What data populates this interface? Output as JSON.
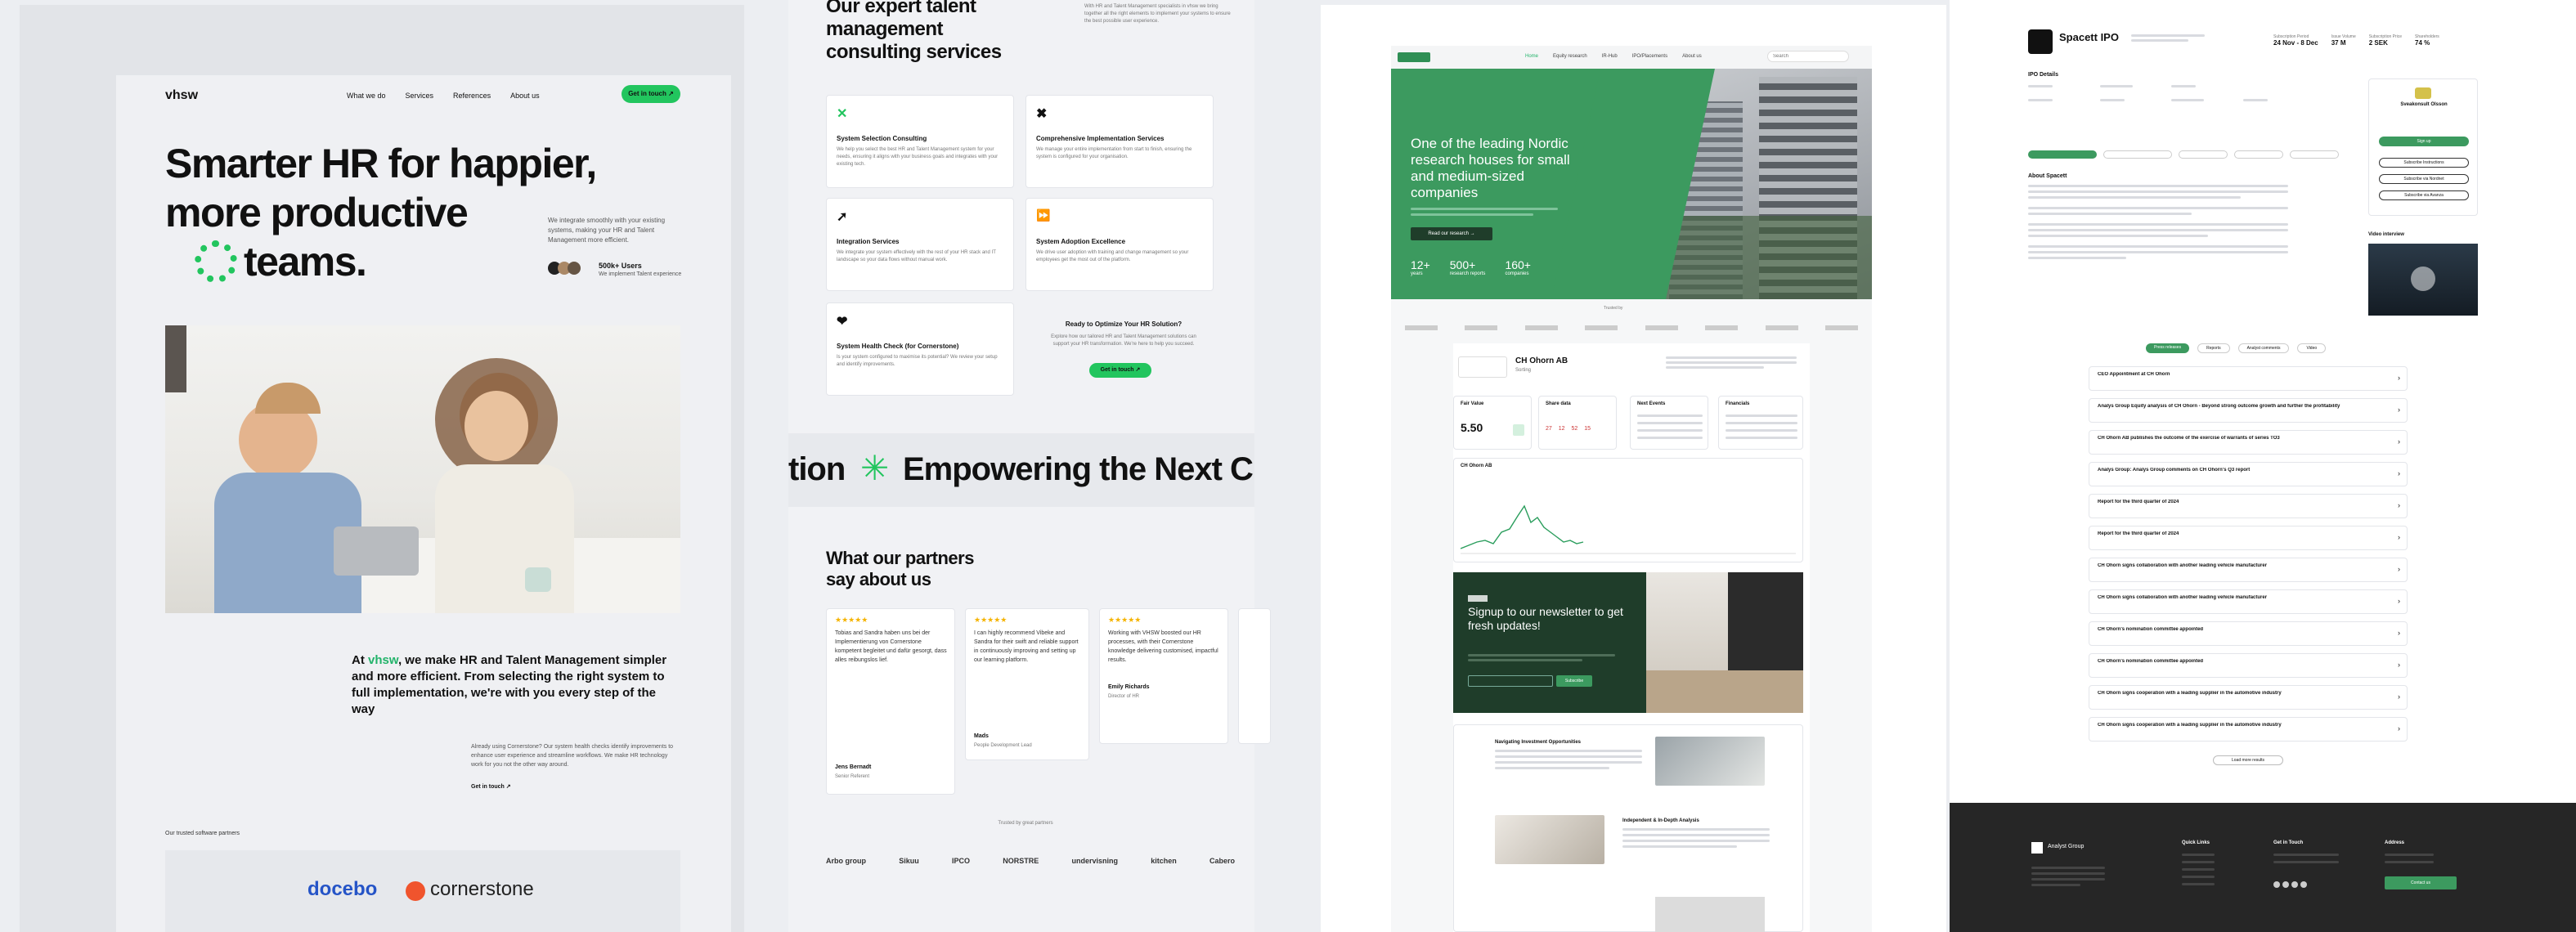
{
  "panel1": {
    "logo": "vhsw",
    "nav": [
      "What we do",
      "Services",
      "References",
      "About us"
    ],
    "nav_button": "Get in touch ↗",
    "hero_line1": "Smarter HR for happier,",
    "hero_line2": "more productive",
    "hero_line3": "teams.",
    "side_text": "We integrate smoothly with your existing systems, making your HR and Talent Management more efficient.",
    "users_count": "500k+ Users",
    "users_sub": "We implement Talent experience",
    "about_prefix": "At ",
    "about_brand": "vhsw",
    "about_rest": ", we make HR and Talent Management simpler and more efficient. From selecting the right system to full implementation, we're with you every step of the way",
    "about_sub": "Already using Cornerstone? Our system health checks identify improvements to enhance user experience and streamline workflows. We make HR technology work for you not the other way around.",
    "about_link": "Get in touch ↗",
    "partners_label": "Our trusted software partners",
    "partner1": "docebo",
    "partner2": "cornerstone"
  },
  "panel2": {
    "heading_line1": "Our expert talent",
    "heading_line2": "management",
    "heading_line3": "consulting services",
    "intro": "With HR and Talent Management specialists in vhsw we bring together all the right elements to implement your systems to ensure the best possible user experience.",
    "services": [
      {
        "title": "System Selection Consulting",
        "text": "We help you select the best HR and Talent Management system for your needs, ensuring it aligns with your business goals and integrates with your existing tech."
      },
      {
        "title": "Comprehensive Implementation Services",
        "text": "We manage your entire implementation from start to finish, ensuring the system is configured for your organisation."
      },
      {
        "title": "Integration Services",
        "text": "We integrate your system effectively with the rest of your HR stack and IT landscape so your data flows without manual work."
      },
      {
        "title": "System Adoption Excellence",
        "text": "We drive user adoption with training and change management so your employees get the most out of the platform."
      },
      {
        "title": "System Health Check (for Cornerstone)",
        "text": "Is your system configured to maximise its potential? We review your setup and identify improvements."
      }
    ],
    "cta_title": "Ready to Optimize Your HR Solution?",
    "cta_text": "Explore how our tailored HR and Talent Management solutions can support your HR transformation. We're here to help you succeed.",
    "cta_button": "Get in touch ↗",
    "marquee_left": "tion",
    "marquee_right": "Empowering the Next C",
    "testimonials_line1": "What our partners",
    "testimonials_line2": "say about us",
    "testimonials": [
      {
        "stars": "★★★★★",
        "text": "Tobias and Sandra haben uns bei der Implementierung von Cornerstone kompetent begleitet und dafür gesorgt, dass alles reibungslos lief.",
        "author": "Jens Bernadt",
        "role": "Senior Referent"
      },
      {
        "stars": "★★★★★",
        "text": "I can highly recommend Vibeke and Sandra for their swift and reliable support in continuously improving and setting up our learning platform.",
        "author": "Mads",
        "role": "People Development Lead"
      },
      {
        "stars": "★★★★★",
        "text": "Working with VHSW boosted our HR processes, with their Cornerstone knowledge delivering customised, impactful results.",
        "author": "Emily Richards",
        "role": "Director of HR"
      }
    ],
    "logos_label": "Trusted by great partners",
    "logos": [
      "Arbo group",
      "Sikuu",
      "IPCO",
      "NORSTRE",
      "undervisning",
      "kitchen",
      "Cabero"
    ]
  },
  "panel3": {
    "nav": [
      "Home",
      "Equity research",
      "IR-Hub",
      "IPO/Placements",
      "About us"
    ],
    "search_placeholder": "Search",
    "hero_title": "One of the leading Nordic research houses for small and medium-sized companies",
    "hero_button": "Read our research →",
    "stats": [
      {
        "value": "12+",
        "label": "years"
      },
      {
        "value": "500+",
        "label": "research reports"
      },
      {
        "value": "160+",
        "label": "companies"
      }
    ],
    "logo_strip_label": "Trusted by",
    "company_name": "CH Ohorn AB",
    "company_sub": "Sorting",
    "stats_cards": [
      {
        "title": "Fair Value",
        "value": "5.50"
      },
      {
        "title": "Share data",
        "value": "27 12 52 15"
      },
      {
        "title": "Next Events",
        "value": ""
      },
      {
        "title": "Financials",
        "value": ""
      }
    ],
    "chart_title": "CH Ohorn AB",
    "newsletter_title": "Signup to our newsletter to get fresh updates!",
    "newsletter_button": "Subscribe",
    "articles": [
      {
        "title": "Navigating Investment Opportunities"
      },
      {
        "title": "Independent & In-Depth Analysis"
      }
    ]
  },
  "panel4": {
    "company_name": "Spacett IPO",
    "header_stats": [
      {
        "label": "Subscription Period",
        "value": "24 Nov - 8 Dec"
      },
      {
        "label": "Issue Volume",
        "value": "37 M"
      },
      {
        "label": "Subscription Price",
        "value": "2 SEK"
      },
      {
        "label": "Shareholders",
        "value": "74 %"
      }
    ],
    "section_details": "IPO Details",
    "tabs": [
      "Press releases",
      "Reports",
      "Analyst comments",
      "Video"
    ],
    "about_title": "About Spacett",
    "video_label": "Video interview",
    "side_card_name": "Sveakonsult Olsson",
    "side_buttons": [
      "Sign up",
      "Subscribe Instructions",
      "Subscribe via Nordnet",
      "Subscribe via Avanza"
    ],
    "list_items": [
      "CEO Appointment at CH Ohorn",
      "Analys Group Equity analysis of CH Ohorn - Beyond strong outcome growth and further the profitability",
      "CH Ohorn AB publishes the outcome of the exercise of warrants of series TO3",
      "Analys Group: Analys Group comments on CH Ohorn's Q3 report",
      "Report for the third quarter of 2024",
      "Report for the third quarter of 2024",
      "CH Ohorn signs collaboration with another leading vehicle manufacturer",
      "CH Ohorn signs collaboration with another leading vehicle manufacturer",
      "CH Ohorn's nomination committee appointed",
      "CH Ohorn's nomination committee appointed",
      "CH Ohorn signs cooperation with a leading supplier in the automotive industry",
      "CH Ohorn signs cooperation with a leading supplier in the automotive industry"
    ],
    "load_more": "Load more results",
    "footer_brand": "Analyst Group",
    "footer_cols": [
      "Quick Links",
      "Get in Touch",
      "Address"
    ],
    "footer_button": "Contact us"
  }
}
